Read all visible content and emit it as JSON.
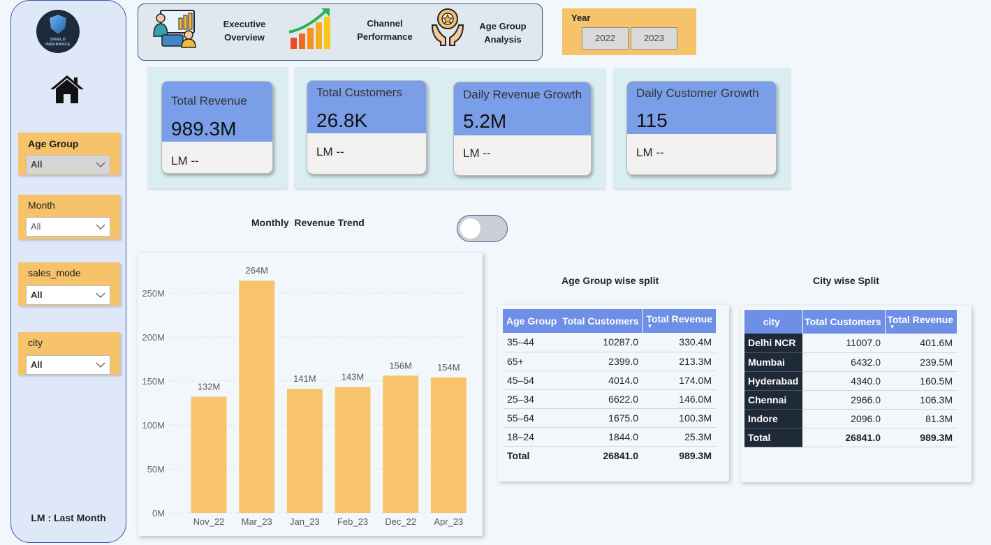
{
  "sidebar": {
    "logo_line1": "SHIELD",
    "logo_line2": "INSURANCE",
    "filters": [
      {
        "label": "Age Group",
        "value": "All"
      },
      {
        "label": "Month",
        "value": "All"
      },
      {
        "label": "sales_mode",
        "value": "All"
      },
      {
        "label": "city",
        "value": "All"
      }
    ],
    "footnote": "LM : Last Month"
  },
  "nav": {
    "items": [
      {
        "line1": "Executive",
        "line2": "Overview",
        "icon": "presentation-icon"
      },
      {
        "line1": "Channel",
        "line2": "Performance",
        "icon": "growth-bars-icon"
      },
      {
        "line1": "Age Group",
        "line2": "Analysis",
        "icon": "hands-star-icon"
      }
    ]
  },
  "year_slicer": {
    "label": "Year",
    "options": [
      "2022",
      "2023"
    ]
  },
  "kpis": [
    {
      "title": "Total Revenue",
      "value": "989.3M",
      "lm": "LM --"
    },
    {
      "title": "Total Customers",
      "value": "26.8K",
      "lm": "LM --"
    },
    {
      "title": "Daily Revenue Growth",
      "value": "5.2M",
      "lm": "LM --"
    },
    {
      "title": "Daily Customer Growth",
      "value": "115",
      "lm": "LM --"
    }
  ],
  "chart_title": "Monthly  Revenue Trend",
  "chart_data": {
    "type": "bar",
    "categories": [
      "Nov_22",
      "Mar_23",
      "Jan_23",
      "Feb_23",
      "Dec_22",
      "Apr_23"
    ],
    "values": [
      132,
      264,
      141,
      143,
      156,
      154
    ],
    "data_labels": [
      "132M",
      "264M",
      "141M",
      "143M",
      "156M",
      "154M"
    ],
    "y_ticks": [
      "0M",
      "50M",
      "100M",
      "150M",
      "200M",
      "250M"
    ],
    "ylim": [
      0,
      280
    ],
    "grid": true,
    "color": "#f8c46b"
  },
  "age_split": {
    "title": "Age Group wise split",
    "columns": [
      "Age Group",
      "Total Customers",
      "Total Revenue"
    ],
    "rows": [
      [
        "35–44",
        "10287.0",
        "330.4M"
      ],
      [
        "65+",
        "2399.0",
        "213.3M"
      ],
      [
        "45–54",
        "4014.0",
        "174.0M"
      ],
      [
        "25–34",
        "6622.0",
        "146.0M"
      ],
      [
        "55–64",
        "1675.0",
        "100.3M"
      ],
      [
        "18–24",
        "1844.0",
        "25.3M"
      ]
    ],
    "total": [
      "Total",
      "26841.0",
      "989.3M"
    ]
  },
  "city_split": {
    "title": "City wise Split",
    "columns": [
      "city",
      "Total Customers",
      "Total Revenue"
    ],
    "rows": [
      [
        "Delhi NCR",
        "11007.0",
        "401.6M"
      ],
      [
        "Mumbai",
        "6432.0",
        "239.5M"
      ],
      [
        "Hyderabad",
        "4340.0",
        "160.5M"
      ],
      [
        "Chennai",
        "2966.0",
        "106.3M"
      ],
      [
        "Indore",
        "2096.0",
        "81.3M"
      ]
    ],
    "total": [
      "Total",
      "26841.0",
      "989.3M"
    ]
  }
}
